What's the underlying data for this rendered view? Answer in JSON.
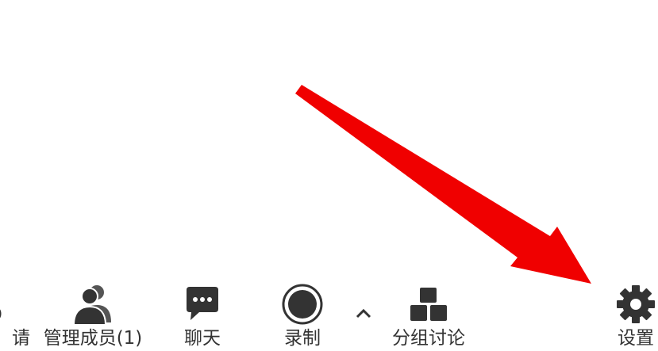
{
  "toolbar": {
    "items": [
      {
        "label": "请",
        "icon": "partial-icon"
      },
      {
        "label": "管理成员(1)",
        "icon": "participants-icon"
      },
      {
        "label": "聊天",
        "icon": "chat-icon"
      },
      {
        "label": "录制",
        "icon": "record-icon"
      },
      {
        "label": "分组讨论",
        "icon": "breakout-rooms-icon"
      },
      {
        "label": "设置",
        "icon": "gear-icon"
      }
    ],
    "record_menu_caret": "chevron-up-icon"
  },
  "annotation": {
    "arrow_color": "#f00000",
    "icon_color": "#333333"
  }
}
